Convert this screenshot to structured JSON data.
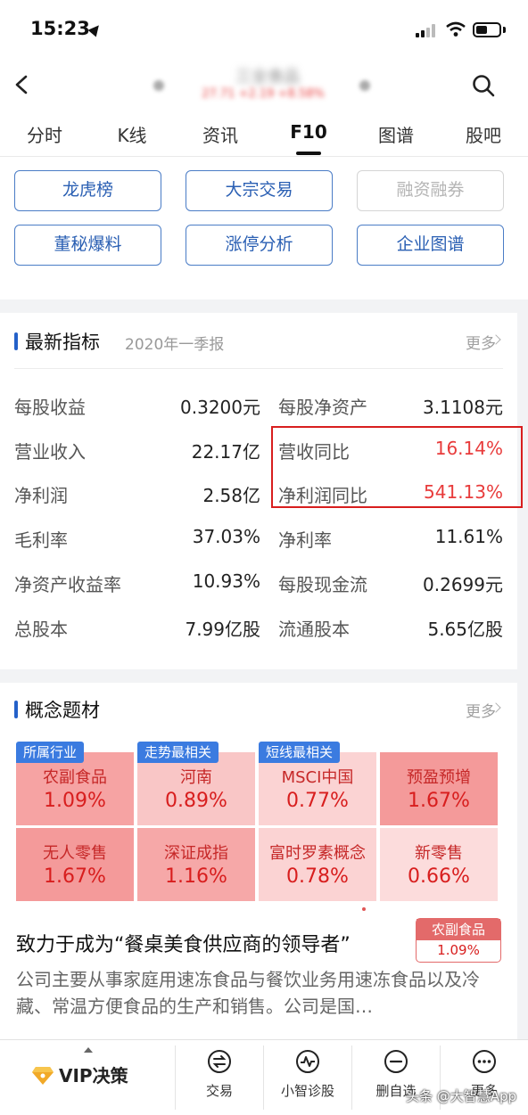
{
  "status_bar": {
    "time": "15:23"
  },
  "header": {
    "stock_name": "三全食品",
    "stock_quote": "27.71 +2.19 +8.58%"
  },
  "tabs": [
    {
      "label": "分时"
    },
    {
      "label": "K线"
    },
    {
      "label": "资讯"
    },
    {
      "label": "F10"
    },
    {
      "label": "图谱"
    },
    {
      "label": "股吧"
    }
  ],
  "active_tab": "F10",
  "quick_buttons": [
    {
      "label": "龙虎榜",
      "enabled": true
    },
    {
      "label": "大宗交易",
      "enabled": true
    },
    {
      "label": "融资融券",
      "enabled": false
    },
    {
      "label": "董秘爆料",
      "enabled": true
    },
    {
      "label": "涨停分析",
      "enabled": true
    },
    {
      "label": "企业图谱",
      "enabled": true
    }
  ],
  "indicators": {
    "title": "最新指标",
    "period": "2020年一季报",
    "more": "更多",
    "rows": [
      {
        "l1": "每股收益",
        "v1": "0.3200元",
        "l2": "每股净资产",
        "v2": "3.1108元"
      },
      {
        "l1": "营业收入",
        "v1": "22.17亿",
        "l2": "营收同比",
        "v2": "16.14%"
      },
      {
        "l1": "净利润",
        "v1": "2.58亿",
        "l2": "净利润同比",
        "v2": "541.13%"
      },
      {
        "l1": "毛利率",
        "v1": "37.03%",
        "l2": "净利率",
        "v2": "11.61%"
      },
      {
        "l1": "净资产收益率",
        "v1": "10.93%",
        "l2": "每股现金流",
        "v2": "0.2699元"
      },
      {
        "l1": "总股本",
        "v1": "7.99亿股",
        "l2": "流通股本",
        "v2": "5.65亿股"
      }
    ]
  },
  "concepts": {
    "title": "概念题材",
    "more": "更多",
    "tiles": [
      {
        "tag": "所属行业",
        "name": "农副食品",
        "pct": "1.09%",
        "shade": "#f6a3a3"
      },
      {
        "tag": "走势最相关",
        "name": "河南",
        "pct": "0.89%",
        "shade": "#f9c6c6"
      },
      {
        "tag": "短线最相关",
        "name": "MSCI中国",
        "pct": "0.77%",
        "shade": "#fbd3d3"
      },
      {
        "tag": "",
        "name": "预盈预增",
        "pct": "1.67%",
        "shade": "#f49a9a"
      },
      {
        "tag": "",
        "name": "无人零售",
        "pct": "1.67%",
        "shade": "#f49a9a"
      },
      {
        "tag": "",
        "name": "深证成指",
        "pct": "1.16%",
        "shade": "#f6a8a8"
      },
      {
        "tag": "",
        "name": "富时罗素概念",
        "pct": "0.78%",
        "shade": "#fbd3d3"
      },
      {
        "tag": "",
        "name": "新零售",
        "pct": "0.66%",
        "shade": "#fcdcdc"
      }
    ],
    "slogan": "致力于成为“餐桌美食供应商的领导者”",
    "badge_name": "农副食品",
    "badge_pct": "1.09%",
    "description": "公司主要从事家庭用速冻食品与餐饮业务用速冻食品以及冷藏、常温方便食品的生产和销售。公司是国…"
  },
  "bottom_bar": {
    "vip_label": "VIP决策",
    "tools": [
      {
        "label": "交易",
        "icon": "exchange-icon"
      },
      {
        "label": "小智诊股",
        "icon": "pulse-icon"
      },
      {
        "label": "删自选",
        "icon": "minus-circle-icon"
      },
      {
        "label": "更多",
        "icon": "more-dots-icon"
      }
    ],
    "watermark": "头条 @大智慧App"
  },
  "colors": {
    "accent": "#2461c9",
    "up_red": "#e83b3b",
    "highlight": "#d81e1e"
  }
}
